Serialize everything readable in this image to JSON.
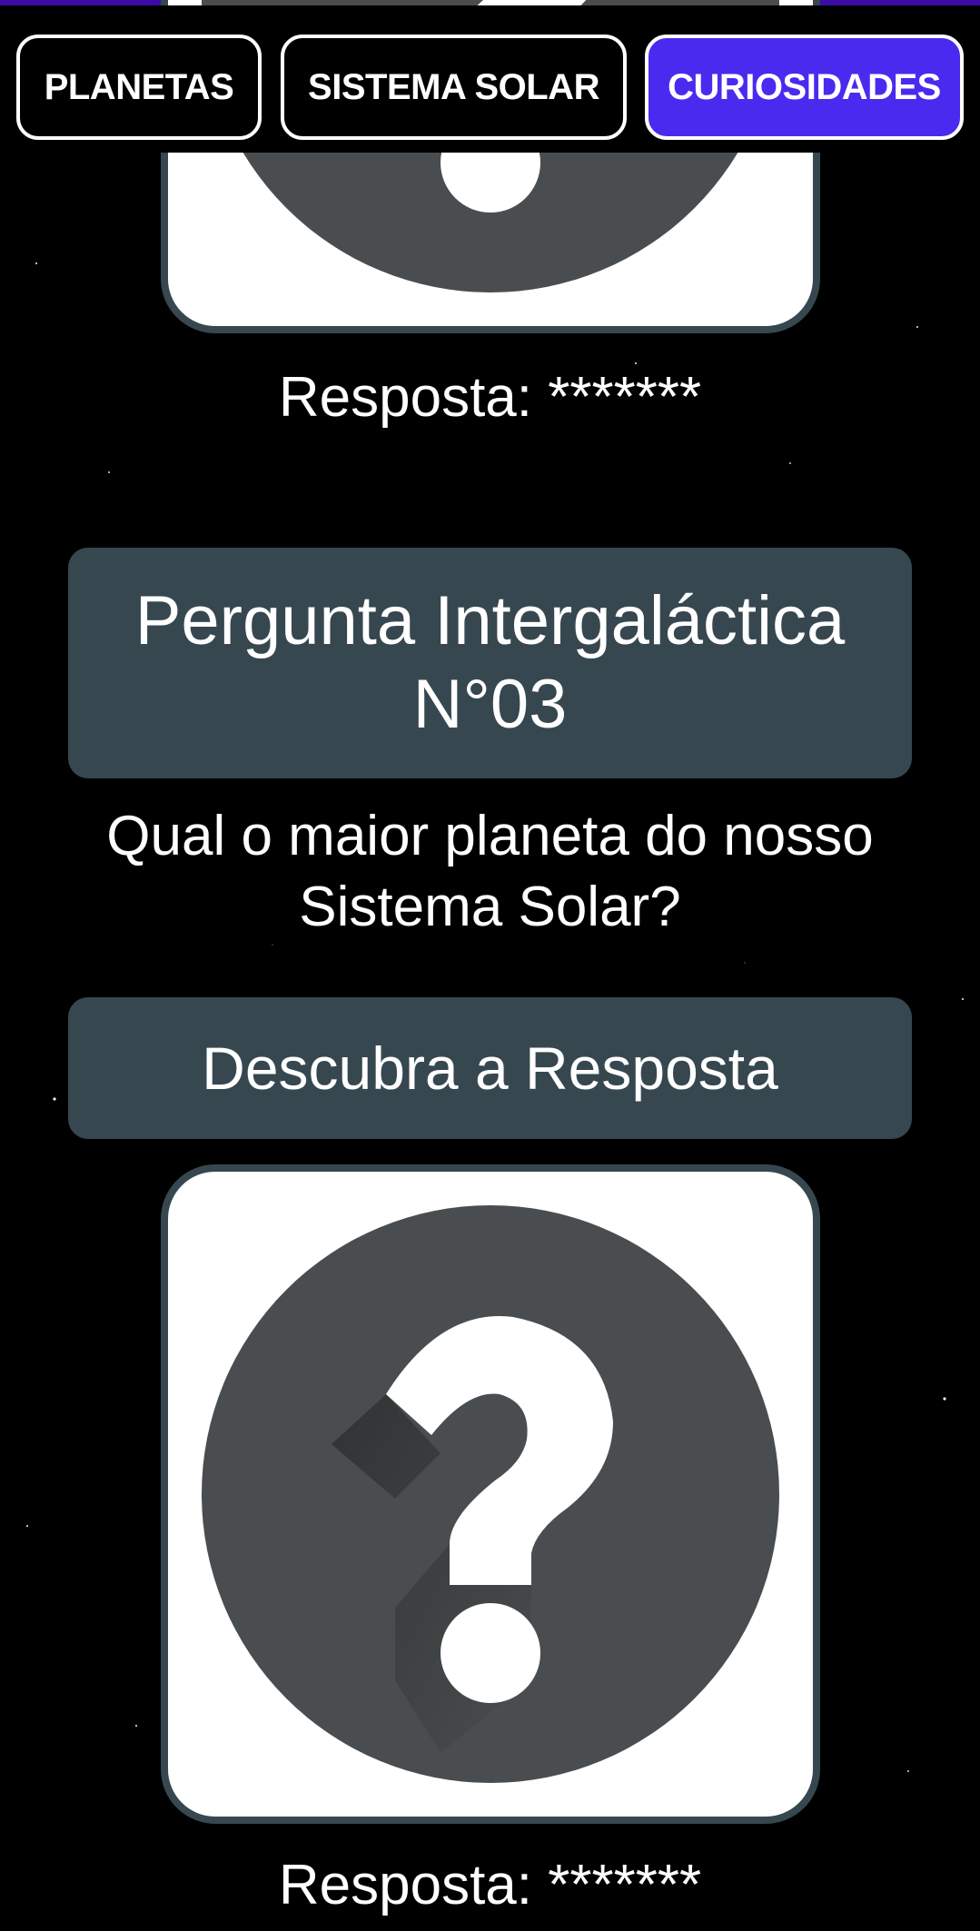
{
  "tabs": [
    {
      "label": "PLANETAS",
      "active": false
    },
    {
      "label": "SISTEMA SOLAR",
      "active": false
    },
    {
      "label": "CURIOSIDADES",
      "active": true
    }
  ],
  "colors": {
    "accent": "#4b2af0",
    "top_bar": "#3a0ca3",
    "panel": "#37474f",
    "icon_circle": "#4a4d4f"
  },
  "previous_card": {
    "image_icon": "question-mark-icon",
    "answer": "Resposta: *******"
  },
  "question_card": {
    "title": "Pergunta Intergaláctica N°03",
    "question": "Qual o maior planeta do nosso Sistema Solar?",
    "reveal_button": "Descubra a Resposta",
    "image_icon": "question-mark-icon",
    "answer": "Resposta: *******"
  }
}
